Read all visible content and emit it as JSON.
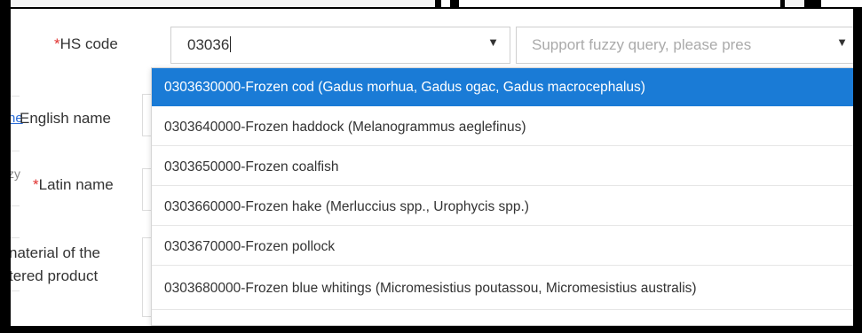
{
  "form": {
    "hs_code_label": "HS code",
    "hs_code_required_mark": "*",
    "hs_code_value": "03036",
    "fuzzy_placeholder": "Support fuzzy query, please pres",
    "english_name_label": "English name",
    "latin_name_label": "Latin name",
    "latin_name_required_mark": "*",
    "material_label_line1": "naterial of the",
    "material_label_line2": "tered product"
  },
  "sliver": {
    "link_text": "he",
    "text_fragment": "zy"
  },
  "dropdown": {
    "options": [
      "0303630000-Frozen cod (Gadus morhua, Gadus ogac, Gadus macrocephalus)",
      "0303640000-Frozen haddock (Melanogrammus aeglefinus)",
      "0303650000-Frozen coalfish",
      "0303660000-Frozen hake (Merluccius spp., Urophycis spp.)",
      "0303670000-Frozen pollock",
      "0303680000-Frozen blue whitings (Micromesistius poutassou, Micromesistius australis)"
    ],
    "selected_index": 0
  },
  "colors": {
    "selected_bg": "#1a7bd6",
    "required": "#e0312f",
    "link": "#2b6cd6"
  },
  "icons": {
    "dropdown_arrow": "caret-down-icon"
  }
}
